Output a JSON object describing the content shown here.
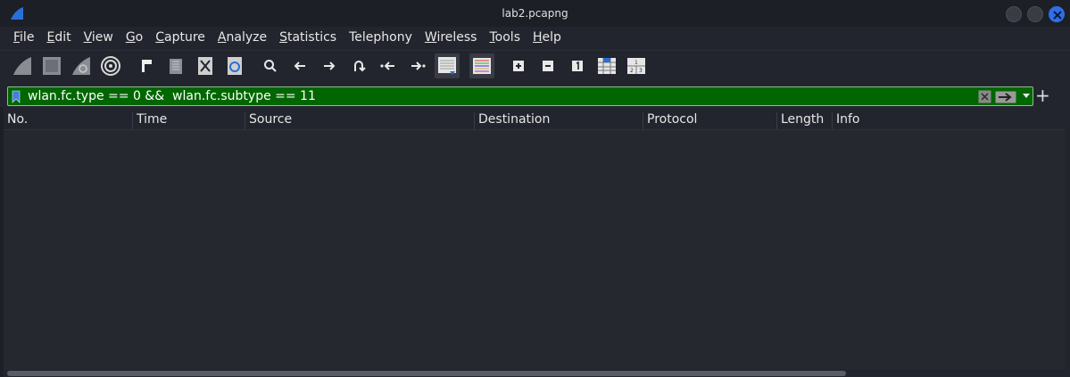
{
  "window": {
    "title": "lab2.pcapng"
  },
  "menu": [
    {
      "label": "File",
      "u": "F",
      "rest": "ile"
    },
    {
      "label": "Edit",
      "u": "E",
      "rest": "dit"
    },
    {
      "label": "View",
      "u": "V",
      "rest": "iew"
    },
    {
      "label": "Go",
      "u": "G",
      "rest": "o"
    },
    {
      "label": "Capture",
      "u": "C",
      "rest": "apture"
    },
    {
      "label": "Analyze",
      "u": "A",
      "rest": "nalyze"
    },
    {
      "label": "Statistics",
      "u": "S",
      "rest": "tatistics"
    },
    {
      "label": "Telephony",
      "u": "",
      "rest": "Telephony"
    },
    {
      "label": "Wireless",
      "u": "W",
      "rest": "ireless"
    },
    {
      "label": "Tools",
      "u": "T",
      "rest": "ools"
    },
    {
      "label": "Help",
      "u": "H",
      "rest": "elp"
    }
  ],
  "toolbar_icons": [
    "shark-fin-start-icon",
    "stop-square-icon",
    "restart-fin-icon",
    "gear-options-icon",
    "open-file-icon",
    "save-file-icon",
    "close-file-icon",
    "reload-file-icon",
    "search-icon",
    "arrow-left-icon",
    "arrow-right-icon",
    "jump-to-icon",
    "first-packet-icon",
    "last-packet-icon",
    "auto-scroll-icon",
    "colorize-icon",
    "zoom-in-icon",
    "zoom-out-icon",
    "normal-size-icon",
    "resize-columns-icon",
    "layout-icon"
  ],
  "filter": {
    "value": "wlan.fc.type == 0 &&  wlan.fc.subtype == 11",
    "color": "#006600"
  },
  "columns": [
    "No.",
    "Time",
    "Source",
    "Destination",
    "Protocol",
    "Length",
    "Info"
  ],
  "rows": []
}
